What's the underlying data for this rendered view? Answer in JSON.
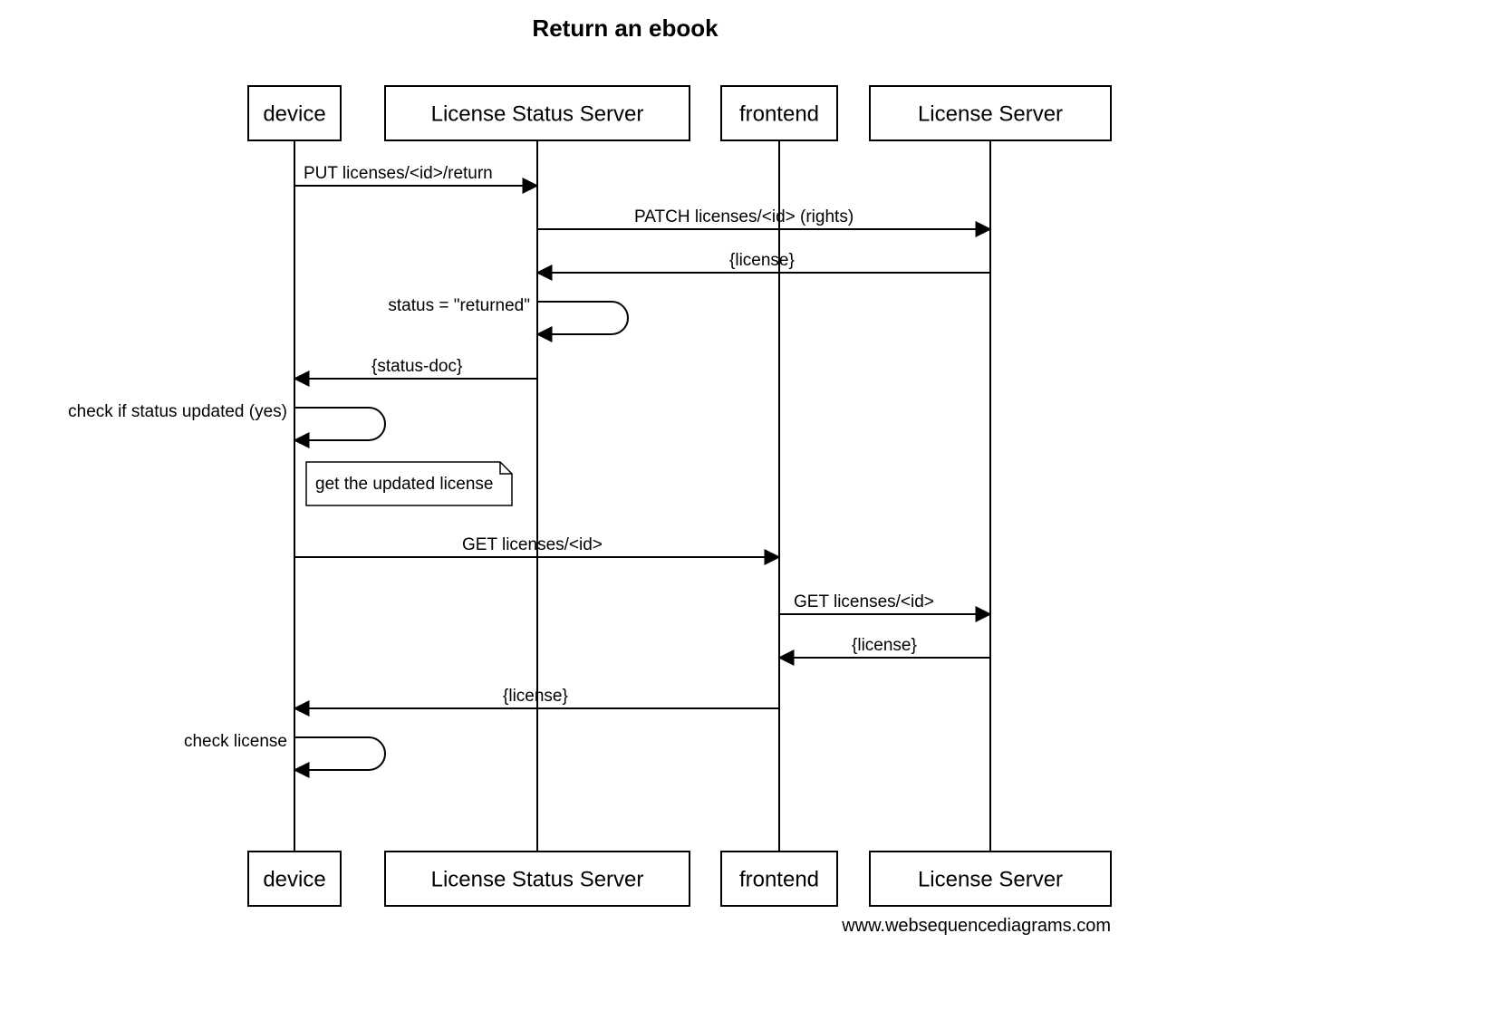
{
  "title": "Return an ebook",
  "footer": "www.websequencediagrams.com",
  "participants": [
    "device",
    "License Status Server",
    "frontend",
    "License Server"
  ],
  "messages": {
    "m1": "PUT licenses/<id>/return",
    "m2": "PATCH licenses/<id> (rights)",
    "m3": "{license}",
    "m4": "status = \"returned\"",
    "m5": "{status-doc}",
    "m6": "check if status updated (yes)",
    "note1": "get the updated license",
    "m7": "GET licenses/<id>",
    "m8": "GET licenses/<id>",
    "m9": "{license}",
    "m10": "{license}",
    "m11": "check license"
  }
}
